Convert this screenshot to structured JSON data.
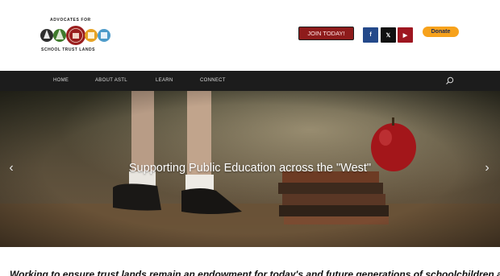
{
  "logo": {
    "top_text": "ADVOCATES FOR",
    "bottom_text": "SCHOOL TRUST LANDS"
  },
  "header": {
    "join_label": "JOIN TODAY!",
    "donate_label": "Donate",
    "social": [
      {
        "icon": "facebook-icon",
        "glyph": "f"
      },
      {
        "icon": "x-icon",
        "glyph": "𝕏"
      },
      {
        "icon": "youtube-icon",
        "glyph": "▶"
      }
    ]
  },
  "nav": {
    "items": [
      "HOME",
      "ABOUT ASTL",
      "LEARN",
      "CONNECT"
    ],
    "search_icon": "search-icon"
  },
  "hero": {
    "title": "Supporting Public Education across the \"West\"",
    "prev_glyph": "‹",
    "next_glyph": "›"
  },
  "tagline": "Working to ensure trust lands remain an endowment for today's and future generations of schoolchildren as intended",
  "colors": {
    "join_bg": "#8e1b1b",
    "donate_bg": "#f7a21c",
    "nav_bg": "#1c1c1c",
    "facebook": "#24498a",
    "x": "#111111",
    "youtube": "#9e1620"
  }
}
